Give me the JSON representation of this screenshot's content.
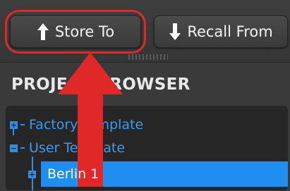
{
  "toolbar": {
    "store_label": "Store To",
    "recall_label": "Recall From"
  },
  "panel": {
    "title": "PROJECT BROWSER"
  },
  "tree": {
    "items": [
      {
        "label": "Factory Template",
        "state": "collapsed"
      },
      {
        "label": "User Template",
        "state": "expanded"
      },
      {
        "label": "Berlin 1",
        "state": "collapsed",
        "selected": true
      }
    ]
  },
  "annotation": {
    "color": "#e02828",
    "highlight": "store-button"
  },
  "colors": {
    "background": "#3b3b3b",
    "tree_accent": "#3b9bf0",
    "selection": "#1f8ef0"
  },
  "icons": {
    "store": "arrow-up-icon",
    "recall": "arrow-down-icon",
    "expand": "plus-box-icon",
    "collapse": "minus-box-icon"
  }
}
